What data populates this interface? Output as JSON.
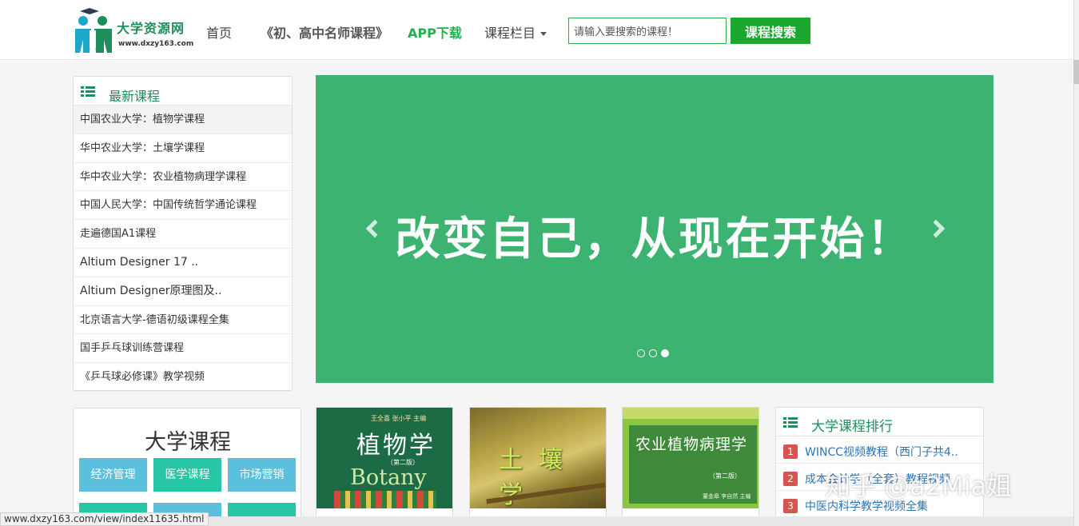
{
  "header": {
    "logo_title": "大学资源网",
    "logo_url": "www.dxzy163.com",
    "nav": {
      "home": "首页",
      "courses": "《初、高中名师课程》",
      "app": "APP下载",
      "categories": "课程栏目"
    },
    "search": {
      "value": "请输入要搜索的课程！",
      "button": "课程搜索"
    }
  },
  "latest": {
    "title": "最新课程",
    "items": [
      "中国农业大学：植物学课程",
      "华中农业大学：土壤学课程",
      "华中农业大学：农业植物病理学课程",
      "中国人民大学：中国传统哲学通论课程",
      "走遍德国A1课程",
      "Altium Designer 17 ..",
      "Altium Designer原理图及..",
      "北京语言大学-德语初级课程全集",
      "国手乒乓球训练营课程",
      "《乒乓球必修课》教学视频"
    ]
  },
  "banner": {
    "text": "改变自己，从现在开始！",
    "slides": 3,
    "active_slide": 3
  },
  "university": {
    "title": "大学课程",
    "tags": [
      "经济管理",
      "医学课程",
      "市场营销"
    ]
  },
  "books": [
    {
      "author": "王全喜 张小平 主编",
      "title": "植物学",
      "edition": "（第二版）",
      "latin": "Botany"
    },
    {
      "title": "土壤学"
    },
    {
      "title": "农业植物病理学",
      "edition": "（第二版）",
      "author": "董金皋 李自然 主编"
    }
  ],
  "ranking": {
    "title": "大学课程排行",
    "items": [
      {
        "num": "1",
        "text": "WINCC视频教程（西门子共4.."
      },
      {
        "num": "2",
        "text": "成本会计学（全套）教程视频"
      },
      {
        "num": "3",
        "text": "中医内科学教学视频全集"
      }
    ]
  },
  "watermark": "知乎 @a2Mia姐",
  "status_url": "www.dxzy163.com/view/index11635.html",
  "colors": {
    "brand_green": "#1e8f5b",
    "banner_green": "#3db371",
    "search_button": "#1aa82e",
    "tag_blue": "#5bc0de",
    "tag_teal": "#26c6a6",
    "rank_badge": "#d9534f"
  }
}
